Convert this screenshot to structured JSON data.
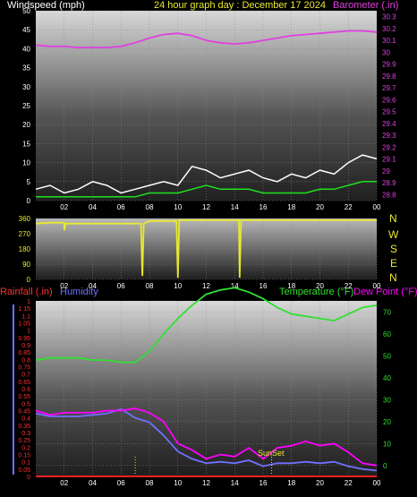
{
  "top": {
    "left_label": "Windspeed (mph)",
    "center_label": "24 hour graph day : December 17 2024",
    "right_label": "Barometer (.in)"
  },
  "dir_panel": {
    "compass": [
      "N",
      "W",
      "S",
      "E",
      "N"
    ]
  },
  "bottom": {
    "left_label": "Rainfall (.in)",
    "left_label2": "Humidity",
    "right_label": "Temperature (°F)",
    "right_label2": "Dew Point (°F)",
    "sunset_label": "SunSet"
  },
  "colors": {
    "barometer": "#e040e0",
    "wind_gust": "#ffffff",
    "wind_avg": "#20e020",
    "direction": "#e8e830",
    "rainfall": "#ff2020",
    "humidity": "#7070ff",
    "temperature": "#30e030",
    "dewpoint": "#ff00ff",
    "left_text_bottom": "#ff3030"
  },
  "chart_data": [
    {
      "type": "line",
      "x_ticks": [
        "02",
        "04",
        "06",
        "08",
        "10",
        "12",
        "14",
        "16",
        "18",
        "20",
        "22",
        "00"
      ],
      "y_left_ticks": [
        "0",
        "5",
        "10",
        "15",
        "20",
        "25",
        "30",
        "35",
        "40",
        "45",
        "50"
      ],
      "ylim_left": [
        0,
        50
      ],
      "y_right_ticks": [
        "28.8",
        "28.9",
        "29",
        "29.1",
        "29.2",
        "29.3",
        "29.4",
        "29.5",
        "29.6",
        "29.7",
        "29.8",
        "29.9",
        "30",
        "30.1",
        "30.2",
        "30.3"
      ],
      "ylim_right": [
        28.75,
        30.35
      ],
      "series": [
        {
          "axis": "right",
          "x": [
            0,
            1,
            2,
            3,
            4,
            5,
            6,
            7,
            8,
            9,
            10,
            11,
            12,
            13,
            14,
            15,
            16,
            17,
            18,
            19,
            20,
            21,
            22,
            23,
            24
          ],
          "values": [
            30.06,
            30.05,
            30.05,
            30.04,
            30.04,
            30.04,
            30.05,
            30.08,
            30.12,
            30.15,
            30.16,
            30.14,
            30.1,
            30.08,
            30.07,
            30.08,
            30.1,
            30.12,
            30.14,
            30.15,
            30.16,
            30.17,
            30.18,
            30.18,
            30.17
          ]
        },
        {
          "axis": "left",
          "x": [
            0,
            1,
            2,
            3,
            4,
            5,
            6,
            7,
            8,
            9,
            10,
            11,
            12,
            13,
            14,
            15,
            16,
            17,
            18,
            19,
            20,
            21,
            22,
            23,
            24
          ],
          "values": [
            3,
            4,
            2,
            3,
            5,
            4,
            2,
            3,
            4,
            5,
            4,
            9,
            8,
            6,
            7,
            8,
            6,
            5,
            7,
            6,
            8,
            7,
            10,
            12,
            11
          ]
        },
        {
          "axis": "left",
          "x": [
            0,
            1,
            2,
            3,
            4,
            5,
            6,
            7,
            8,
            9,
            10,
            11,
            12,
            13,
            14,
            15,
            16,
            17,
            18,
            19,
            20,
            21,
            22,
            23,
            24
          ],
          "values": [
            1,
            1,
            1,
            1,
            1,
            1,
            1,
            1,
            2,
            2,
            2,
            3,
            4,
            3,
            3,
            3,
            2,
            2,
            2,
            2,
            3,
            3,
            4,
            5,
            5
          ]
        }
      ]
    },
    {
      "type": "line",
      "x_ticks": [
        "02",
        "04",
        "06",
        "08",
        "10",
        "12",
        "14",
        "16",
        "18",
        "20",
        "22",
        "00"
      ],
      "y_ticks": [
        "0",
        "90",
        "180",
        "270",
        "360"
      ],
      "ylim": [
        0,
        360
      ],
      "series": [
        {
          "x": [
            0,
            1,
            2,
            2.0,
            2.1,
            3,
            5,
            7,
            7.4,
            7.5,
            7.6,
            8,
            9.9,
            10.0,
            10.1,
            12,
            14.3,
            14.35,
            14.45,
            16,
            20,
            24
          ],
          "values": [
            330,
            335,
            335,
            290,
            330,
            330,
            330,
            330,
            330,
            20,
            330,
            345,
            345,
            10,
            350,
            350,
            350,
            10,
            350,
            350,
            350,
            350
          ]
        }
      ]
    },
    {
      "type": "line",
      "x_ticks": [
        "02",
        "04",
        "06",
        "08",
        "10",
        "12",
        "14",
        "16",
        "18",
        "20",
        "22",
        "00"
      ],
      "y_left_ticks": [
        "0",
        "0.05",
        "0.1",
        "0.15",
        "0.2",
        "0.25",
        "0.3",
        "0.35",
        "0.4",
        "0.45",
        "0.5",
        "0.55",
        "0.6",
        "0.65",
        "0.7",
        "0.75",
        "0.8",
        "0.85",
        "0.9",
        "0.95",
        "1",
        "1.05",
        "1.1",
        "1.15",
        "1"
      ],
      "ylim_left": [
        0,
        1.2
      ],
      "y_right_ticks": [
        "0",
        "10",
        "20",
        "30",
        "40",
        "50",
        "60",
        "70"
      ],
      "ylim_right": [
        -5,
        75
      ],
      "series": [
        {
          "axis": "right",
          "x": [
            0,
            1,
            2,
            3,
            4,
            5,
            6,
            7,
            8,
            9,
            10,
            11,
            12,
            13,
            14,
            15,
            16,
            17,
            18,
            19,
            20,
            21,
            22,
            23,
            24
          ],
          "values": [
            48,
            49,
            49,
            49,
            48,
            48,
            47,
            47,
            52,
            60,
            67,
            73,
            78,
            80,
            81,
            79,
            76,
            72,
            69,
            68,
            67,
            66,
            69,
            72,
            73
          ]
        },
        {
          "axis": "right",
          "x": [
            0,
            1,
            2,
            3,
            4,
            5,
            6,
            7,
            8,
            9,
            10,
            11,
            12,
            13,
            14,
            15,
            16,
            17,
            18,
            19,
            20,
            21,
            22,
            23,
            24
          ],
          "values": [
            25,
            23,
            24,
            24,
            24,
            25,
            25,
            26,
            24,
            20,
            10,
            7,
            3,
            5,
            4,
            8,
            3,
            8,
            9,
            11,
            9,
            10,
            6,
            1,
            0
          ]
        },
        {
          "axis": "left",
          "x": [
            0,
            1,
            2,
            3,
            4,
            5,
            6,
            7,
            8,
            9,
            10,
            11,
            12,
            13,
            14,
            15,
            16,
            17,
            18,
            19,
            20,
            21,
            22,
            23,
            24
          ],
          "values": [
            0.43,
            0.41,
            0.41,
            0.41,
            0.42,
            0.43,
            0.46,
            0.4,
            0.37,
            0.28,
            0.17,
            0.12,
            0.09,
            0.1,
            0.09,
            0.11,
            0.07,
            0.09,
            0.09,
            0.1,
            0.09,
            0.1,
            0.07,
            0.05,
            0.04
          ]
        },
        {
          "axis": "left",
          "x": [
            0,
            24
          ],
          "values": [
            0,
            0
          ]
        }
      ]
    }
  ]
}
